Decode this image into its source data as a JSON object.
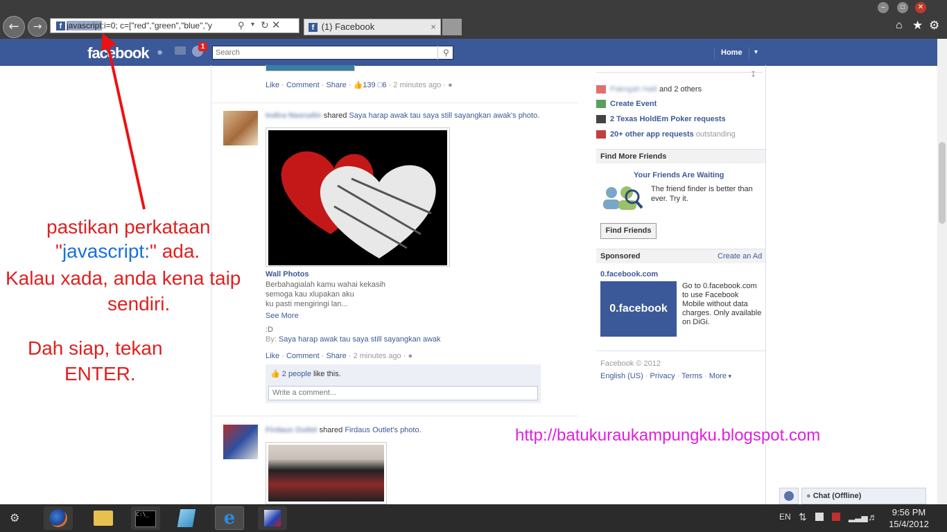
{
  "browser": {
    "url_highlight": "javascript",
    "url_rest": ":i=0; c=[\"red\",\"green\",\"blue\",\"y",
    "tab_title": "(1) Facebook",
    "tab_close": "×"
  },
  "fb": {
    "logo": "facebook",
    "notification_badge": "1",
    "search_placeholder": "Search",
    "home": "Home"
  },
  "post1": {
    "like": "Like",
    "comment": "Comment",
    "share": "Share",
    "likes_count": "139",
    "comments_count": "6",
    "time": "2 minutes ago"
  },
  "post2": {
    "author": "Indira Nasrudin",
    "shared_text": "shared",
    "photo_owner": "Saya harap awak tau saya still sayangkan awak's photo.",
    "album": "Wall Photos",
    "caption_lines": [
      "Berbahagialah kamu wahai kekasih",
      "semoga kau xlupakan aku",
      "ku pasti mengiringi lan..."
    ],
    "see_more": "See More",
    "extra": ":D",
    "by_label": "By:",
    "by_name": "Saya harap awak tau saya still sayangkan awak",
    "like": "Like",
    "comment": "Comment",
    "share": "Share",
    "time": "2 minutes ago",
    "people_count": "2 people",
    "likes_suffix": "like this.",
    "comment_placeholder": "Write a comment..."
  },
  "post3": {
    "author": "Firdaus Outlet",
    "shared_text": "shared",
    "photo_owner": "Firdaus Outlet's photo."
  },
  "sidebar": {
    "friend_req_name": "Pakngah Halil",
    "friend_req_rest": "and 2 others",
    "create_event": "Create Event",
    "poker": "2 Texas HoldEm Poker requests",
    "app_requests": "20+ other app requests",
    "app_requests_suffix": "outstanding",
    "find_more_title": "Find More Friends",
    "waiting_title": "Your Friends Are Waiting",
    "waiting_text": "The friend finder is better than ever. Try it.",
    "find_friends_btn": "Find Friends",
    "sponsored": "Sponsored",
    "create_ad": "Create an Ad",
    "ad_title": "0.facebook.com",
    "ad_image_text": "0.facebook",
    "ad_text": "Go to 0.facebook.com to use Facebook Mobile without data charges. Only available on DiGi.",
    "copyright": "Facebook © 2012",
    "footer_links": [
      "English (US)",
      "Privacy",
      "Terms",
      "More"
    ]
  },
  "chat": {
    "label": "Chat (Offline)"
  },
  "annotations": {
    "line1": "pastikan perkataan",
    "line2_q1": "\"",
    "line2_js": "javascript:",
    "line2_q2": "\" ada.",
    "line3": "Kalau xada, anda kena taip",
    "line4": "sendiri.",
    "line5": "Dah siap, tekan",
    "line6": "ENTER.",
    "blog_url": "http://batukuraukampungku.blogspot.com",
    "colors": {
      "red": "#e02020",
      "blue": "#1a6fe0",
      "magenta": "#e020e0"
    }
  },
  "taskbar": {
    "lang": "EN",
    "time": "9:56 PM",
    "date": "15/4/2012"
  }
}
